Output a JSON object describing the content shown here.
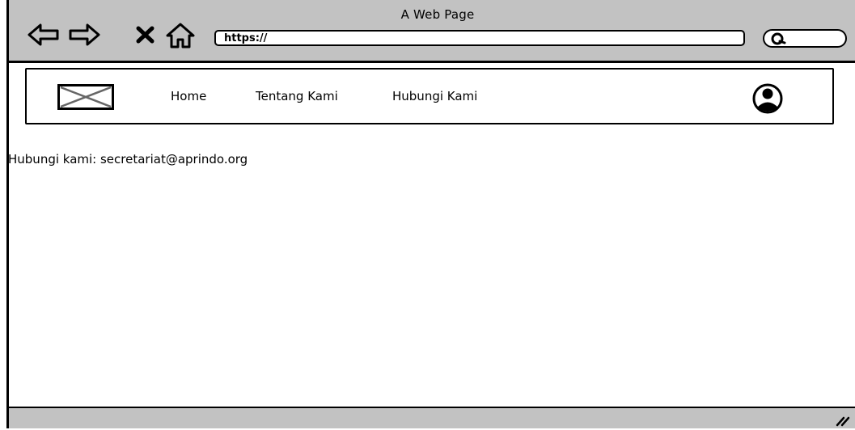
{
  "window": {
    "title": "A Web Page"
  },
  "toolbar": {
    "back_icon": "back-arrow-icon",
    "forward_icon": "forward-arrow-icon",
    "stop_icon": "close-icon",
    "home_icon": "home-icon",
    "url_value": "https://",
    "search_icon": "search-icon"
  },
  "header": {
    "logo_icon": "image-placeholder-icon",
    "nav": [
      {
        "label": "Home"
      },
      {
        "label": "Tentang Kami"
      },
      {
        "label": "Hubungi Kami"
      }
    ],
    "avatar_icon": "user-avatar-icon"
  },
  "main": {
    "contact_text": "Hubungi kami: secretariat@aprindo.org"
  },
  "colors": {
    "chrome_gray": "#c2c2c2",
    "stroke": "#000000",
    "background": "#ffffff"
  }
}
